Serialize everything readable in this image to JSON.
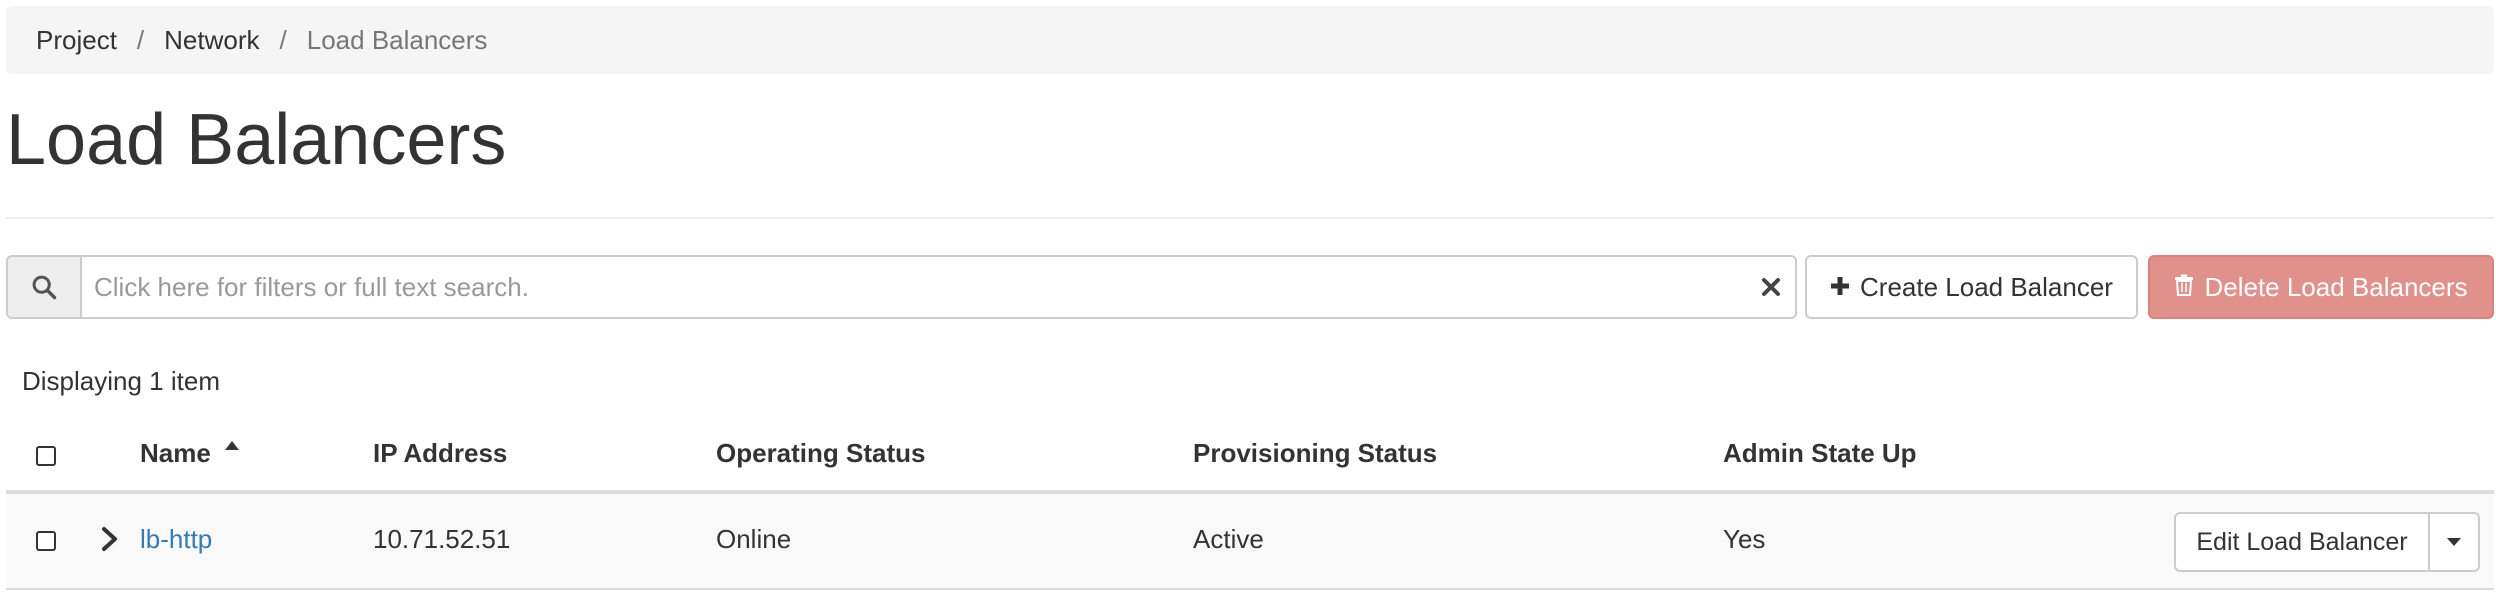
{
  "breadcrumb": {
    "items": [
      "Project",
      "Network"
    ],
    "separator": "/",
    "active": "Load Balancers"
  },
  "page_title": "Load Balancers",
  "search": {
    "placeholder": "Click here for filters or full text search.",
    "value": ""
  },
  "actions": {
    "create_label": "Create Load Balancer",
    "delete_label": "Delete Load Balancers"
  },
  "count_text": "Displaying 1 item",
  "table": {
    "columns": [
      "Name",
      "IP Address",
      "Operating Status",
      "Provisioning Status",
      "Admin State Up"
    ],
    "sorted_column": "Name",
    "rows": [
      {
        "name": "lb-http",
        "ip_address": "10.71.52.51",
        "operating_status": "Online",
        "provisioning_status": "Active",
        "admin_state_up": "Yes",
        "action_label": "Edit Load Balancer"
      }
    ]
  },
  "icons": {
    "search": "search-icon",
    "clear": "close-icon",
    "create": "plus-icon",
    "delete": "trash-icon",
    "sort": "sort-asc-icon",
    "expand": "chevron-right-icon",
    "dropdown": "caret-down-icon"
  },
  "colors": {
    "link": "#337ab7",
    "danger_disabled": "#e0918c",
    "breadcrumb_bg": "#f5f5f5",
    "row_bg": "#f9f9f9"
  }
}
